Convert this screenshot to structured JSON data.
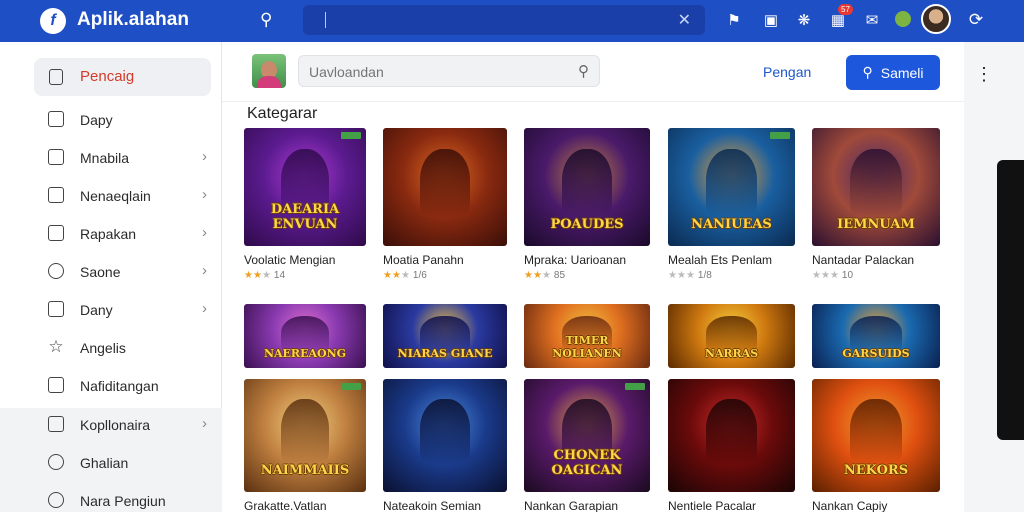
{
  "header": {
    "app_title": "Aplik.alahan",
    "search_placeholder": "",
    "icons": [
      "search-icon",
      "clear-icon",
      "store-icon",
      "apps-icon",
      "settings-icon",
      "notifications-icon",
      "chat-icon",
      "status-icon",
      "profile-avatar",
      "refresh-icon"
    ],
    "notification_count": "57"
  },
  "sidebar": {
    "active": {
      "label": "Pencaig",
      "icon": "file-icon"
    },
    "items": [
      {
        "label": "Dapy",
        "icon": "grid-icon",
        "chevron": false
      },
      {
        "label": "Mnabila",
        "icon": "list-icon",
        "chevron": true
      },
      {
        "label": "Nenaeqlain",
        "icon": "chart-icon",
        "chevron": true
      },
      {
        "label": "Rapakan",
        "icon": "document-icon",
        "chevron": true
      },
      {
        "label": "Saone",
        "icon": "search-icon",
        "chevron": true
      },
      {
        "label": "Dany",
        "icon": "book-icon",
        "chevron": true
      },
      {
        "label": "Angelis",
        "icon": "star-icon",
        "chevron": false
      },
      {
        "label": "Nafiditangan",
        "icon": "message-icon",
        "chevron": false
      },
      {
        "label": "Kopllonaira",
        "icon": "badge-icon",
        "chevron": true
      },
      {
        "label": "Ghalian",
        "icon": "clock-icon",
        "chevron": false
      },
      {
        "label": "Nara Pengiun",
        "icon": "settings-icon",
        "chevron": false
      }
    ]
  },
  "toolbar": {
    "search_placeholder": "Uavloandan",
    "link_label": "Pengan",
    "primary_label": "Sameli"
  },
  "section_title": "Kategarar",
  "games": [
    {
      "title": "Voolatic Mengian",
      "logo": "DAEARIA ENVUAN",
      "stars": 2,
      "rating": "14",
      "colors": [
        "#5b1b8f",
        "#b03ad6",
        "#2f0a4a"
      ]
    },
    {
      "title": "Moatia Panahn",
      "logo": "",
      "stars": 2,
      "rating": "1/6",
      "colors": [
        "#8a2a10",
        "#e06a20",
        "#3a0e08"
      ]
    },
    {
      "title": "Mpraka: Uarioanan",
      "logo": "POAUDES",
      "stars": 2,
      "rating": "85",
      "colors": [
        "#4a1a6a",
        "#c08040",
        "#1a0a2a"
      ]
    },
    {
      "title": "Mealah Ets Penlam",
      "logo": "NANIUEAS",
      "stars": 0,
      "rating": "1/8",
      "colors": [
        "#1a5fa0",
        "#f0a030",
        "#0a2a50"
      ]
    },
    {
      "title": "Nantadar Palackan",
      "logo": "IEMNUAM",
      "stars": 0,
      "rating": "10",
      "colors": [
        "#a04a3a",
        "#4a2a6a",
        "#2a1030"
      ]
    },
    {
      "title": "",
      "logo": "NAEREAONG",
      "stars": 0,
      "rating": "",
      "colors": [
        "#8a3ab0",
        "#e070d0",
        "#3a1050"
      ]
    },
    {
      "title": "",
      "logo": "NIARAS GIANE",
      "stars": 0,
      "rating": "",
      "colors": [
        "#2a3aa0",
        "#f0c040",
        "#10104a"
      ]
    },
    {
      "title": "",
      "logo": "TIMER NOLIANEN",
      "stars": 0,
      "rating": "",
      "colors": [
        "#e07020",
        "#f0c040",
        "#6a2a10"
      ]
    },
    {
      "title": "",
      "logo": "NARRAS",
      "stars": 0,
      "rating": "",
      "colors": [
        "#d07a10",
        "#f6d040",
        "#5a2a00"
      ]
    },
    {
      "title": "",
      "logo": "GARSUIDS",
      "stars": 0,
      "rating": "",
      "colors": [
        "#1a6ab0",
        "#f0a030",
        "#0a2050"
      ]
    },
    {
      "title": "Grakatte.Vatlan",
      "logo": "NAIMMAIIS",
      "stars": 0,
      "rating": "",
      "colors": [
        "#c08040",
        "#f0d080",
        "#5a3010"
      ]
    },
    {
      "title": "Nateakoin Semian",
      "logo": "",
      "stars": 0,
      "rating": "",
      "colors": [
        "#1a3a8a",
        "#4a8ae0",
        "#0a1030"
      ]
    },
    {
      "title": "Nankan Garapian",
      "logo": "CHONEK OAGICAN",
      "stars": 0,
      "rating": "",
      "colors": [
        "#5a1a6a",
        "#e0a040",
        "#1a0a20"
      ]
    },
    {
      "title": "Nentiele Pacalar",
      "logo": "",
      "stars": 0,
      "rating": "",
      "colors": [
        "#6a0a0a",
        "#d02a2a",
        "#1a0505"
      ]
    },
    {
      "title": "Nankan Capiy",
      "logo": "NEKORS",
      "stars": 0,
      "rating": "",
      "colors": [
        "#e05010",
        "#f0a030",
        "#5a2000"
      ]
    }
  ]
}
